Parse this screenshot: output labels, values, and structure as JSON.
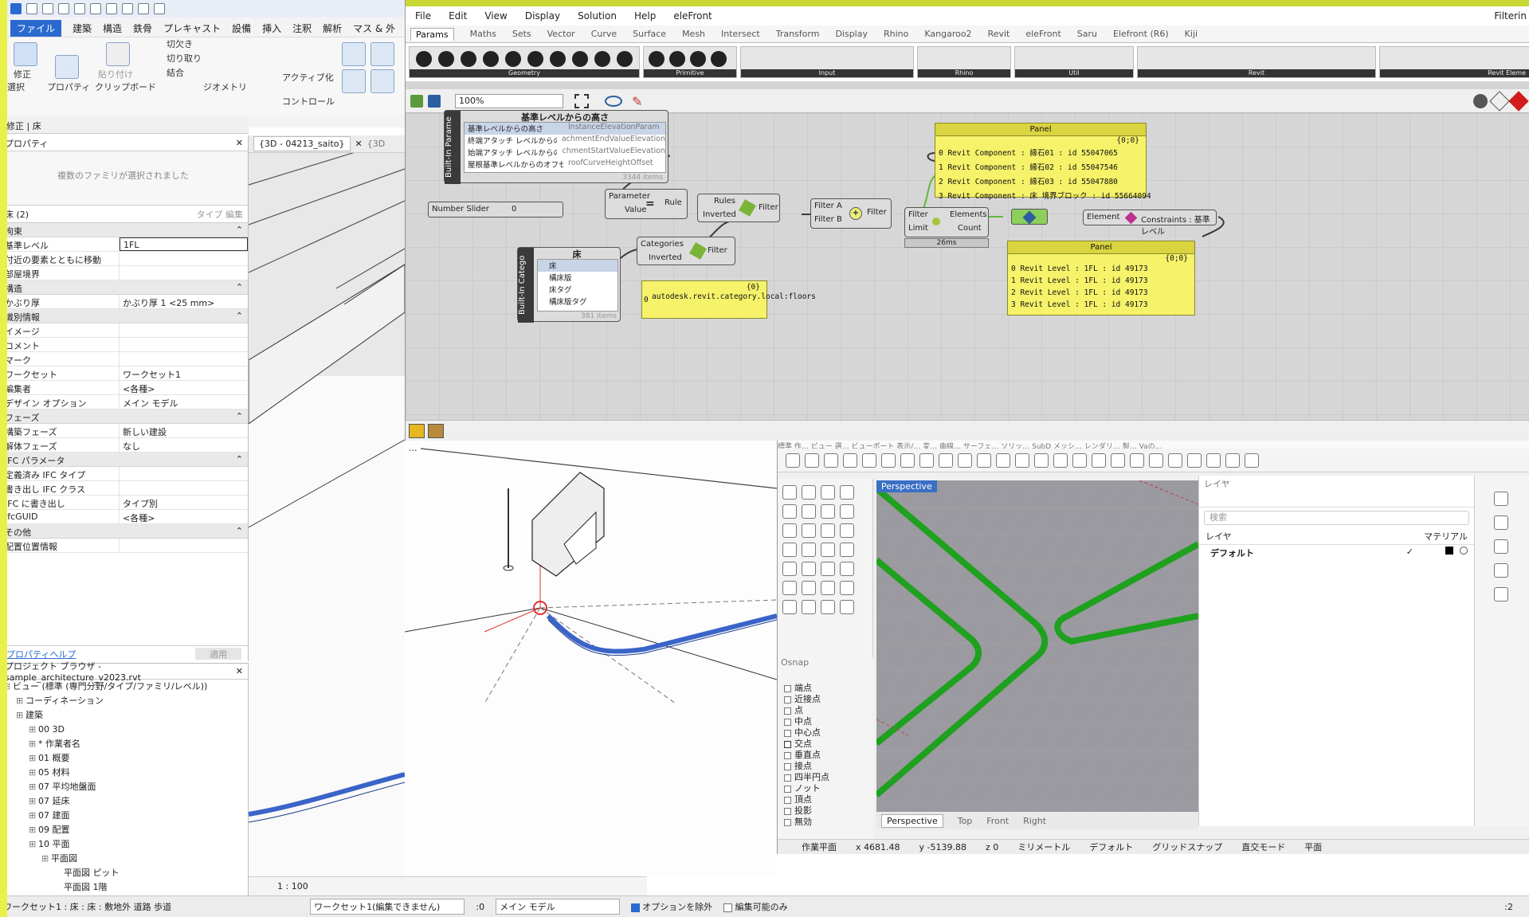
{
  "revit": {
    "menu": [
      "ファイル",
      "建築",
      "構造",
      "鉄骨",
      "プレキャスト",
      "設備",
      "挿入",
      "注釈",
      "解析",
      "マス & 外"
    ],
    "ribbon": {
      "modify": "修正",
      "select": "選択",
      "properties": "プロパティ",
      "paste": "貼り付け",
      "clipboard": "クリップボード",
      "cut_join": "切欠き",
      "cut_join2": "切り取り",
      "join": "結合",
      "geometry": "ジオメトリ",
      "activate": "アクティブ化",
      "control": "コントロール"
    },
    "modify_strip": "修正 | 床",
    "properties_panel": {
      "title": "プロパティ",
      "family_note": "複数のファミリが選択されました",
      "type_selector": "床 (2)",
      "edit_type": "タイプ 編集",
      "groups": [
        {
          "name": "拘束",
          "rows": [
            [
              "基準レベル",
              "1FL"
            ],
            [
              "付近の要素とともに移動",
              ""
            ],
            [
              "部屋境界",
              ""
            ]
          ]
        },
        {
          "name": "構造",
          "rows": [
            [
              "かぶり厚",
              "かぶり厚 1 <25 mm>"
            ]
          ]
        },
        {
          "name": "識別情報",
          "rows": [
            [
              "イメージ",
              ""
            ],
            [
              "コメント",
              ""
            ],
            [
              "マーク",
              ""
            ],
            [
              "ワークセット",
              "ワークセット1"
            ],
            [
              "編集者",
              "<各種>"
            ],
            [
              "デザイン オプション",
              "メイン モデル"
            ]
          ]
        },
        {
          "name": "フェーズ",
          "rows": [
            [
              "構築フェーズ",
              "新しい建設"
            ],
            [
              "解体フェーズ",
              "なし"
            ]
          ]
        },
        {
          "name": "IFC パラメータ",
          "rows": [
            [
              "定義済み IFC タイプ",
              ""
            ],
            [
              "書き出し IFC クラス",
              ""
            ],
            [
              "IFC に書き出し",
              "タイプ別"
            ],
            [
              "IfcGUID",
              "<各種>"
            ]
          ]
        },
        {
          "name": "その他",
          "rows": [
            [
              "配置位置情報",
              ""
            ]
          ]
        }
      ],
      "help": "プロパティヘルプ",
      "apply": "適用"
    },
    "browser": {
      "title": "プロジェクト ブラウザ - sample_architecture_v2023.rvt",
      "items": [
        "ビュー (標準 (専門分野/タイプ/ファミリ/レベル))",
        "コーディネーション",
        "建築",
        "00 3D",
        "* 作業者名",
        "01 概要",
        "05 材料",
        "07 平均地盤面",
        "07 延床",
        "07 建面",
        "09 配置",
        "10 平面",
        "平面図",
        "平面図 ピット",
        "平面図 1階"
      ]
    },
    "view_tab": "{3D - 04213_saito}",
    "view_tab2": "{3D",
    "scale": "1 : 100",
    "status": {
      "left": "ワークセット1 : 床 : 床 : 敷地外 道路 歩道",
      "workset": "ワークセット1(編集できません)",
      "count": ":0",
      "model": "メイン モデル",
      "exclude": "オプションを除外",
      "editable": "編集可能のみ",
      "filter": ":2"
    }
  },
  "grasshopper": {
    "menu": [
      "File",
      "Edit",
      "View",
      "Display",
      "Solution",
      "Help",
      "eleFront"
    ],
    "menu_right": "Filterin",
    "tabs": [
      "Params",
      "Maths",
      "Sets",
      "Vector",
      "Curve",
      "Surface",
      "Mesh",
      "Intersect",
      "Transform",
      "Display",
      "Rhino",
      "Kangaroo2",
      "Revit",
      "eleFront",
      "Saru",
      "Elefront (R6)",
      "Kiji"
    ],
    "groups": [
      "Geometry",
      "Primitive",
      "Input",
      "Rhino",
      "Util",
      "Revit",
      "Revit Eleme"
    ],
    "zoom": "100%",
    "param_list": {
      "title": "基準レベルからの高さ",
      "caption": "Built-In Parame",
      "items": [
        "基準レベルからの高さ",
        "終端アタッチ レベルからの高さ",
        "始端アタッチ レベルからの高さ",
        "屋根基準レベルからのオフセット"
      ],
      "values": [
        "InstanceElevationParam",
        "achmentEndValueElevation",
        "chmentStartValueElevation",
        "roofCurveHeightOffset"
      ],
      "count": "3344 items"
    },
    "slider": {
      "label": "Number Slider",
      "value": "0"
    },
    "parameter": {
      "in1": "Parameter",
      "in2": "Value",
      "out": "Rule",
      "sym": "="
    },
    "rules": {
      "in1": "Rules",
      "in2": "Inverted",
      "out": "Filter"
    },
    "filterab": {
      "in1": "Filter A",
      "in2": "Filter B",
      "out": "Filter"
    },
    "elements": {
      "in1": "Filter",
      "in2": "Limit",
      "out1": "Elements",
      "out2": "Count",
      "time": "26ms"
    },
    "element_comp": {
      "in": "Element",
      "out": "Constraints : 基準レベル"
    },
    "category_list": {
      "title": "床",
      "caption": "Built-In Catego",
      "items": [
        "床",
        "構床版",
        "床タグ",
        "構床版タグ"
      ],
      "count": "381 items"
    },
    "categories": {
      "in1": "Categories",
      "in2": "Inverted",
      "out": "Filter"
    },
    "panel_cat": {
      "header": "{0}",
      "index": "0",
      "text": "autodesk.revit.category.local:floors"
    },
    "panel_top": {
      "title": "Panel",
      "path": "{0;0}",
      "lines": [
        "0 Revit Component : 縁石01 : id 55047065",
        "1 Revit Component : 縁石02 : id 55047546",
        "2 Revit Component : 縁石03 : id 55047880",
        "3 Revit Component : 床 境界ブロック : id 55664094"
      ]
    },
    "panel_bottom": {
      "title": "Panel",
      "path": "{0;0}",
      "lines": [
        "0 Revit Level : 1FL : id 49173",
        "1 Revit Level : 1FL : id 49173",
        "2 Revit Level : 1FL : id 49173",
        "3 Revit Level : 1FL : id 49173"
      ]
    },
    "footer": "..."
  },
  "rhino": {
    "menu": "標準 作… ビュー 選… ビューポート 表示/… 変… 曲線… サーフェ… ソリッ… SubD メッシ… レンダリ… 製… Vaの…",
    "viewport_title": "Perspective",
    "viewport_tabs": [
      "Perspective",
      "Top",
      "Front",
      "Right"
    ],
    "osnap_title": "Osnap",
    "osnap": [
      "端点",
      "近接点",
      "点",
      "中点",
      "中心点",
      "交点",
      "垂直点",
      "接点",
      "四半円点",
      "ノット",
      "頂点",
      "投影",
      "無効"
    ],
    "layers_title": "レイヤ",
    "search_placeholder": "検索",
    "layer_col": "レイヤ",
    "material_col": "マテリアル",
    "layer_default": "デフォルト",
    "status": [
      "作業平面",
      "x 4681.48",
      "y -5139.88",
      "z 0",
      "ミリメートル",
      "デフォルト",
      "グリッドスナップ",
      "直交モード",
      "平面"
    ]
  },
  "colors": {
    "gh_canvas": "#d6d6d6",
    "panel_yellow": "#f6f26a",
    "rhino_green": "#1fa11f",
    "revit_blue": "#2a6ad0"
  }
}
